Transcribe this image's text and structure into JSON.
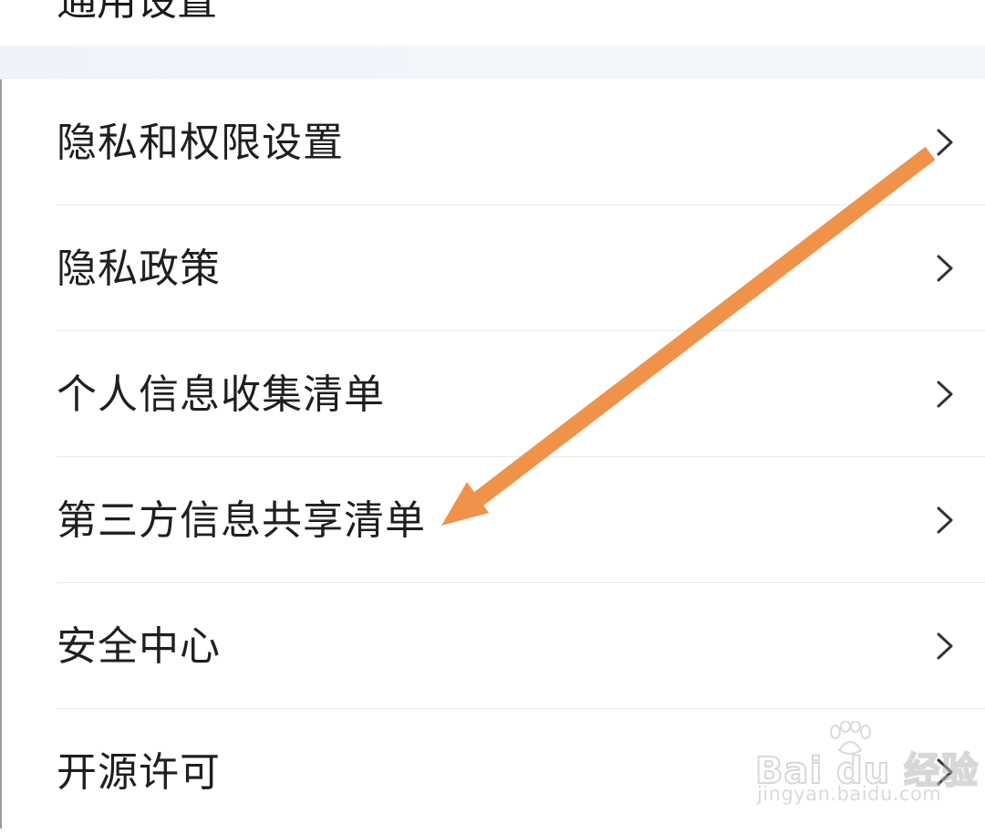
{
  "top_item": {
    "label": "通用设置"
  },
  "menu": {
    "items": [
      {
        "label": "隐私和权限设置",
        "icon": "chevron-right-icon"
      },
      {
        "label": "隐私政策",
        "icon": "chevron-right-icon"
      },
      {
        "label": "个人信息收集清单",
        "icon": "chevron-right-icon"
      },
      {
        "label": "第三方信息共享清单",
        "icon": "chevron-right-icon"
      },
      {
        "label": "安全中心",
        "icon": "chevron-right-icon"
      },
      {
        "label": "开源许可",
        "icon": "chevron-right-icon"
      }
    ]
  },
  "annotation": {
    "color": "#f0924a",
    "icon": "arrow-icon"
  },
  "watermark": {
    "brand": "Bai du 经验",
    "url": "jingyan.baidu.com"
  },
  "colors": {
    "background": "#ffffff",
    "section_gap": "#f1f5fa",
    "text": "#1f1f1f",
    "chevron": "#333333",
    "divider": "#e8e8e8"
  }
}
